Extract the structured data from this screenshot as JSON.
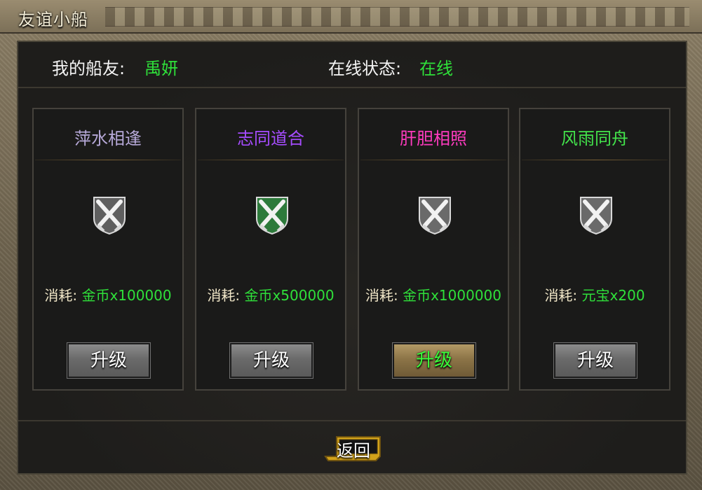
{
  "window": {
    "title": "友谊小船"
  },
  "info": {
    "friend_label": "我的船友:",
    "friend_value": "禹妍",
    "status_label": "在线状态:",
    "status_value": "在线"
  },
  "cards": [
    {
      "name": "萍水相逢",
      "name_color": "#b7a9d9",
      "cost_label": "消耗:",
      "cost_value": "金币x100000",
      "button": "升级",
      "emblem_color": "#6a6a6a"
    },
    {
      "name": "志同道合",
      "name_color": "#a64cff",
      "cost_label": "消耗:",
      "cost_value": "金币x500000",
      "button": "升级",
      "emblem_color": "#2d7a3b"
    },
    {
      "name": "肝胆相照",
      "name_color": "#ff3bbf",
      "cost_label": "消耗:",
      "cost_value": "金币x1000000",
      "button": "升级",
      "emblem_color": "#6a6a6a"
    },
    {
      "name": "风雨同舟",
      "name_color": "#43e34b",
      "cost_label": "消耗:",
      "cost_value": "元宝x200",
      "button": "升级",
      "emblem_color": "#6a6a6a"
    }
  ],
  "footer": {
    "back_label": "返回"
  },
  "colors": {
    "accent_green": "#2fe03a",
    "frame": "#6f644f",
    "panel": "#1e1d1b"
  },
  "icons": [
    "crossed-swords-shield-icon"
  ]
}
